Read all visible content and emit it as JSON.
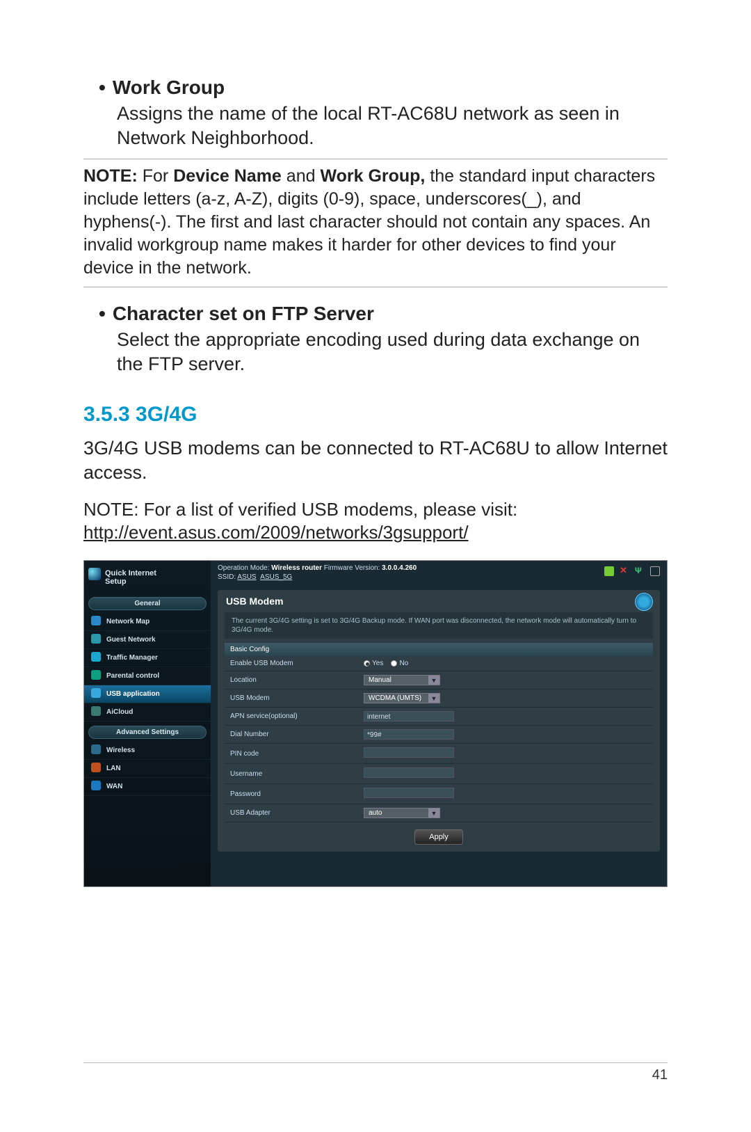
{
  "sections": {
    "work_group": {
      "title": "Work Group",
      "body": "Assigns the name of the local RT-AC68U network as seen in Network Neighborhood."
    },
    "note1_prefix": "NOTE:",
    "note1_mid1": " For ",
    "note1_bold1": "Device Name",
    "note1_mid2": " and ",
    "note1_bold2": "Work Group,",
    "note1_rest": " the standard input characters include letters (a-z, A-Z), digits (0-9), space, underscores(_), and hyphens(-). The first and last character should not contain any spaces. An invalid workgroup name makes it harder for other devices to find your device in the network.",
    "char_set": {
      "title": "Character set on FTP Server",
      "body": "Select the appropriate encoding used during data exchange on the FTP server."
    },
    "g3g4": {
      "heading": "3.5.3 3G/4G",
      "body": "3G/4G USB modems can be connected to RT-AC68U to allow Internet access.",
      "note": "NOTE:  For a list of verified USB modems, please visit:",
      "link": "http://event.asus.com/2009/networks/3gsupport/"
    }
  },
  "router": {
    "qis_line1": "Quick Internet",
    "qis_line2": "Setup",
    "group_general": "General",
    "items_general": [
      "Network Map",
      "Guest Network",
      "Traffic Manager",
      "Parental control",
      "USB application",
      "AiCloud"
    ],
    "group_advanced": "Advanced Settings",
    "items_advanced": [
      "Wireless",
      "LAN",
      "WAN"
    ],
    "top": {
      "op_label": "Operation Mode: ",
      "op_value": "Wireless router",
      "fw_label": "   Firmware Version: ",
      "fw_value": "3.0.0.4.260",
      "ssid_label": "SSID: ",
      "ssid1": "ASUS",
      "ssid2": "ASUS_5G"
    },
    "panel": {
      "title": "USB Modem",
      "desc": "The current 3G/4G setting is set to 3G/4G Backup mode. If WAN port was disconnected, the network mode will automatically turn to 3G/4G mode.",
      "subhead": "Basic Config",
      "rows": {
        "enable": {
          "label": "Enable USB Modem",
          "yes": "Yes",
          "no": "No"
        },
        "location": {
          "label": "Location",
          "value": "Manual"
        },
        "usb_modem": {
          "label": "USB Modem",
          "value": "WCDMA (UMTS)"
        },
        "apn": {
          "label": "APN service(optional)",
          "value": "internet"
        },
        "dial": {
          "label": "Dial Number",
          "value": "*99#"
        },
        "pin": {
          "label": "PIN code",
          "value": ""
        },
        "user": {
          "label": "Username",
          "value": ""
        },
        "pass": {
          "label": "Password",
          "value": ""
        },
        "adapter": {
          "label": "USB Adapter",
          "value": "auto"
        }
      },
      "apply": "Apply"
    }
  },
  "page_number": "41"
}
